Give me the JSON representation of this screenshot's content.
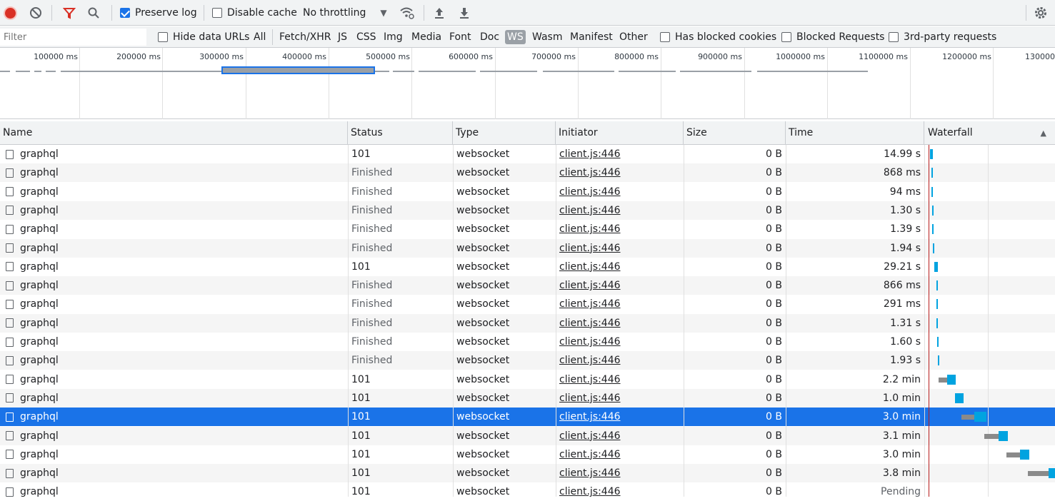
{
  "toolbar": {
    "preserve_log": "Preserve log",
    "disable_cache": "Disable cache",
    "throttling": "No throttling"
  },
  "filterbar": {
    "filter_placeholder": "Filter",
    "hide_data_urls": "Hide data URLs",
    "types": [
      "All",
      "Fetch/XHR",
      "JS",
      "CSS",
      "Img",
      "Media",
      "Font",
      "Doc",
      "WS",
      "Wasm",
      "Manifest",
      "Other"
    ],
    "active_type": "WS",
    "has_blocked_cookies": "Has blocked cookies",
    "blocked_requests": "Blocked Requests",
    "third_party": "3rd-party requests"
  },
  "overview": {
    "ticks": [
      "100000 ms",
      "200000 ms",
      "300000 ms",
      "400000 ms",
      "500000 ms",
      "600000 ms",
      "700000 ms",
      "800000 ms",
      "900000 ms",
      "1000000 ms",
      "1100000 ms",
      "1200000 ms",
      "130000"
    ]
  },
  "columns": {
    "name": "Name",
    "status": "Status",
    "type": "Type",
    "initiator": "Initiator",
    "size": "Size",
    "time": "Time",
    "waterfall": "Waterfall"
  },
  "rows": [
    {
      "name": "graphql",
      "status": "101",
      "type": "websocket",
      "initiator": "client.js:446",
      "size": "0 B",
      "time": "14.99 s"
    },
    {
      "name": "graphql",
      "status": "Finished",
      "type": "websocket",
      "initiator": "client.js:446",
      "size": "0 B",
      "time": "868 ms"
    },
    {
      "name": "graphql",
      "status": "Finished",
      "type": "websocket",
      "initiator": "client.js:446",
      "size": "0 B",
      "time": "94 ms"
    },
    {
      "name": "graphql",
      "status": "Finished",
      "type": "websocket",
      "initiator": "client.js:446",
      "size": "0 B",
      "time": "1.30 s"
    },
    {
      "name": "graphql",
      "status": "Finished",
      "type": "websocket",
      "initiator": "client.js:446",
      "size": "0 B",
      "time": "1.39 s"
    },
    {
      "name": "graphql",
      "status": "Finished",
      "type": "websocket",
      "initiator": "client.js:446",
      "size": "0 B",
      "time": "1.94 s"
    },
    {
      "name": "graphql",
      "status": "101",
      "type": "websocket",
      "initiator": "client.js:446",
      "size": "0 B",
      "time": "29.21 s"
    },
    {
      "name": "graphql",
      "status": "Finished",
      "type": "websocket",
      "initiator": "client.js:446",
      "size": "0 B",
      "time": "866 ms"
    },
    {
      "name": "graphql",
      "status": "Finished",
      "type": "websocket",
      "initiator": "client.js:446",
      "size": "0 B",
      "time": "291 ms"
    },
    {
      "name": "graphql",
      "status": "Finished",
      "type": "websocket",
      "initiator": "client.js:446",
      "size": "0 B",
      "time": "1.31 s"
    },
    {
      "name": "graphql",
      "status": "Finished",
      "type": "websocket",
      "initiator": "client.js:446",
      "size": "0 B",
      "time": "1.60 s"
    },
    {
      "name": "graphql",
      "status": "Finished",
      "type": "websocket",
      "initiator": "client.js:446",
      "size": "0 B",
      "time": "1.93 s"
    },
    {
      "name": "graphql",
      "status": "101",
      "type": "websocket",
      "initiator": "client.js:446",
      "size": "0 B",
      "time": "2.2 min"
    },
    {
      "name": "graphql",
      "status": "101",
      "type": "websocket",
      "initiator": "client.js:446",
      "size": "0 B",
      "time": "1.0 min"
    },
    {
      "name": "graphql",
      "status": "101",
      "type": "websocket",
      "initiator": "client.js:446",
      "size": "0 B",
      "time": "3.0 min"
    },
    {
      "name": "graphql",
      "status": "101",
      "type": "websocket",
      "initiator": "client.js:446",
      "size": "0 B",
      "time": "3.1 min"
    },
    {
      "name": "graphql",
      "status": "101",
      "type": "websocket",
      "initiator": "client.js:446",
      "size": "0 B",
      "time": "3.0 min"
    },
    {
      "name": "graphql",
      "status": "101",
      "type": "websocket",
      "initiator": "client.js:446",
      "size": "0 B",
      "time": "3.8 min"
    },
    {
      "name": "graphql",
      "status": "101",
      "type": "websocket",
      "initiator": "client.js:446",
      "size": "0 B",
      "time": "Pending"
    }
  ],
  "selected_row": 14,
  "colors": {
    "accent": "#1a73e8",
    "record": "#d93025",
    "filter_icon": "#d93025",
    "waterfall_bar": "#00a3e0"
  }
}
